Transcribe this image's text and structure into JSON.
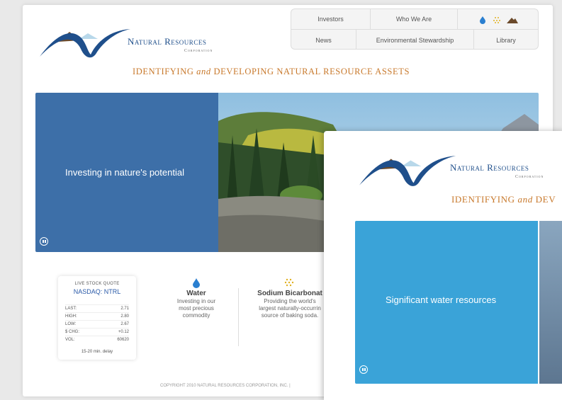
{
  "colors": {
    "brand_blue": "#1f4f8b",
    "tagline_orange": "#c8792c",
    "panel_blue": "#3d6fa8",
    "panel_light_blue": "#3aa3d8"
  },
  "brand": {
    "name": "Natural Resources",
    "sub": "Corporation"
  },
  "nav": {
    "row1": [
      "Investors",
      "Who We Are"
    ],
    "row2": [
      "News",
      "Environmental Stewardship",
      "Library"
    ],
    "icons": [
      "water-drop-icon",
      "sodium-dots-icon",
      "mountain-icon"
    ]
  },
  "tagline": {
    "pre": "IDENTIFYING ",
    "em": "and",
    "post": " DEVELOPING NATURAL RESOURCE ASSETS"
  },
  "hero": {
    "caption": "Investing in nature's potential"
  },
  "stock": {
    "title": "LIVE STOCK QUOTE",
    "symbol": "NASDAQ: NTRL",
    "rows": [
      {
        "label": "LAST:",
        "value": "2.71"
      },
      {
        "label": "HIGH:",
        "value": "2.80"
      },
      {
        "label": "LOW:",
        "value": "2.67"
      },
      {
        "label": "$ CHG:",
        "value": "+0.12"
      },
      {
        "label": "VOL:",
        "value": "60620"
      }
    ],
    "delay": "15-20 min. delay"
  },
  "features": [
    {
      "icon": "water-drop-icon",
      "title": "Water",
      "lines": [
        "Investing in our",
        "most precious",
        "commodity"
      ]
    },
    {
      "icon": "sodium-dots-icon",
      "title": "Sodium Bicarbonat",
      "lines": [
        "Providing the world's",
        "largest naturally-occurrin",
        "source of baking soda."
      ]
    }
  ],
  "copyright": "COPYRIGHT 2010 NATURAL RESOURCES CORPORATION, INC.  |",
  "overlay": {
    "brand_name": "Natural Resources",
    "brand_sub": "Corporation",
    "tagline_pre": "IDENTIFYING ",
    "tagline_em": "and",
    "tagline_post": " DEV",
    "caption": "Significant water resources"
  }
}
